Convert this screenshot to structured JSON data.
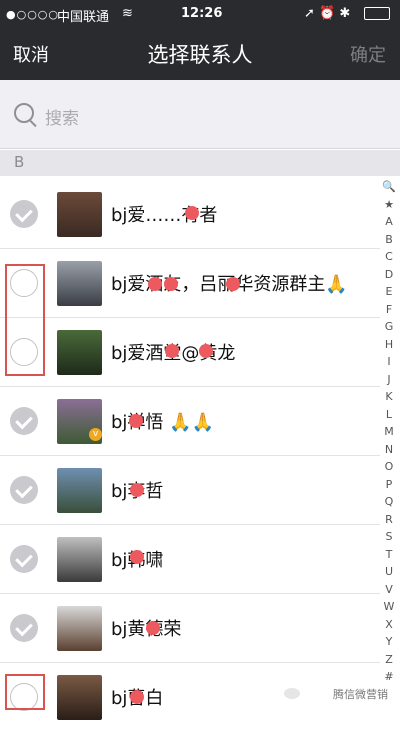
{
  "status_bar": {
    "signal": "●○○○○",
    "carrier": "中国联通",
    "wifi_icon": "wifi-icon",
    "time": "12:26",
    "right_icons": "➚ ⏰ ✱"
  },
  "nav": {
    "cancel": "取消",
    "title": "选择联系人",
    "confirm": "确定"
  },
  "search": {
    "placeholder": "搜索"
  },
  "section_header": "B",
  "contacts": [
    {
      "name": "bj爱……有者",
      "checked": true
    },
    {
      "name": "bj爱酒友，吕丽华资源群主🙏",
      "checked": false
    },
    {
      "name": "bj爱酒堂@黄龙",
      "checked": false
    },
    {
      "name": "bj禅悟 🙏🙏",
      "checked": true
    },
    {
      "name": "bj李哲",
      "checked": true
    },
    {
      "name": "bj韩啸",
      "checked": true
    },
    {
      "name": "bj黄德荣",
      "checked": true
    },
    {
      "name": "bj曹白",
      "checked": false
    }
  ],
  "index_letters": [
    "🔍",
    "★",
    "A",
    "B",
    "C",
    "D",
    "E",
    "F",
    "G",
    "H",
    "I",
    "J",
    "K",
    "L",
    "M",
    "N",
    "O",
    "P",
    "Q",
    "R",
    "S",
    "T",
    "U",
    "V",
    "W",
    "X",
    "Y",
    "Z",
    "#"
  ],
  "watermark": "腾信微营销",
  "colors": {
    "navbar": "#2a2b2f",
    "highlight": "#d9534f",
    "redaction": "#ec5a5f"
  }
}
